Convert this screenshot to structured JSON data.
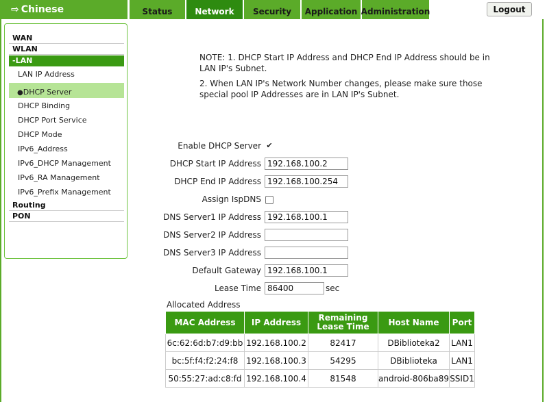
{
  "header": {
    "language": "Chinese",
    "tabs": [
      {
        "label": "Status"
      },
      {
        "label": "Network"
      },
      {
        "label": "Security"
      },
      {
        "label": "Application"
      },
      {
        "label": "Administration"
      }
    ],
    "active_tab": "Network",
    "logout_label": "Logout"
  },
  "sidebar": {
    "wan": "WAN",
    "wlan": "WLAN",
    "lan": "-LAN",
    "lan_items": [
      "LAN IP Address",
      "DHCP Server",
      "DHCP Binding",
      "DHCP Port Service",
      "DHCP Mode",
      "IPv6_Address",
      "IPv6_DHCP Management",
      "IPv6_RA Management",
      "IPv6_Prefix Management"
    ],
    "active_item": "DHCP Server",
    "routing": "Routing",
    "pon": "PON"
  },
  "note": {
    "line1a": "NOTE:  1. DHCP Start IP Address and DHCP End IP Address should be in",
    "line1b": "LAN IP's Subnet.",
    "line2a": "2. When LAN IP's Network Number changes, please make sure those",
    "line2b": "special pool IP Addresses are in LAN IP's Subnet."
  },
  "form": {
    "enable_dhcp_label": "Enable DHCP Server",
    "enable_dhcp_checked": true,
    "start_ip_label": "DHCP Start IP Address",
    "start_ip": "192.168.100.2",
    "end_ip_label": "DHCP End IP Address",
    "end_ip": "192.168.100.254",
    "assign_ispdns_label": "Assign IspDNS",
    "assign_ispdns_checked": false,
    "dns1_label": "DNS Server1 IP Address",
    "dns1": "192.168.100.1",
    "dns2_label": "DNS Server2 IP Address",
    "dns2": "",
    "dns3_label": "DNS Server3 IP Address",
    "dns3": "",
    "gateway_label": "Default Gateway",
    "gateway": "192.168.100.1",
    "lease_label": "Lease Time",
    "lease": "86400",
    "lease_unit": "sec"
  },
  "allocated": {
    "title": "Allocated Address",
    "headers": [
      "MAC Address",
      "IP Address",
      "Remaining Lease Time",
      "Host Name",
      "Port"
    ],
    "header_lease_a": "Remaining",
    "header_lease_b": "Lease Time",
    "rows": [
      {
        "mac": "6c:62:6d:b7:d9:bb",
        "ip": "192.168.100.2",
        "lease": "82417",
        "host": "DBiblioteka2",
        "port": "LAN1"
      },
      {
        "mac": "bc:5f:f4:f2:24:f8",
        "ip": "192.168.100.3",
        "lease": "54295",
        "host": "DBiblioteka",
        "port": "LAN1"
      },
      {
        "mac": "50:55:27:ad:c8:fd",
        "ip": "192.168.100.4",
        "lease": "81548",
        "host": "android-806ba89",
        "port": "SSID1"
      }
    ]
  },
  "colors": {
    "brand_green": "#5bab29",
    "active_green": "#2e8b10",
    "highlight": "#b6e496"
  }
}
